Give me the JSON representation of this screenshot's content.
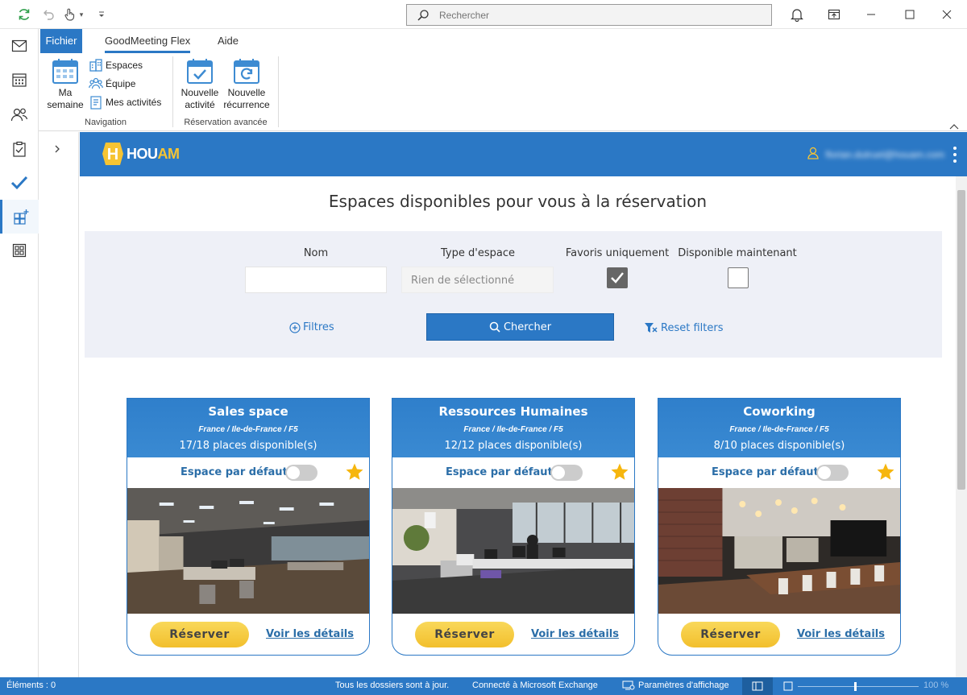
{
  "titlebar": {
    "search_placeholder": "Rechercher",
    "icons": [
      "sync-icon",
      "undo-icon",
      "touch-mode-icon",
      "customize-icon",
      "bell-icon",
      "coming-soon-icon",
      "minimize-icon",
      "maximize-icon",
      "close-icon"
    ]
  },
  "ribbon": {
    "tabs": [
      {
        "label": "Fichier"
      },
      {
        "label": "GoodMeeting Flex"
      },
      {
        "label": "Aide"
      }
    ],
    "navigation": {
      "ma_semaine": "Ma semaine",
      "ma_semaine_l1": "Ma",
      "ma_semaine_l2": "semaine",
      "espaces": "Espaces",
      "equipe": "Équipe",
      "mes_activites": "Mes activités",
      "group_label": "Navigation"
    },
    "reservation": {
      "nouvelle_activite_l1": "Nouvelle",
      "nouvelle_activite_l2": "activité",
      "nouvelle_recurrence_l1": "Nouvelle",
      "nouvelle_recurrence_l2": "récurrence",
      "group_label": "Réservation avancée"
    }
  },
  "app": {
    "logo_h": "H",
    "logo_text_a": "HOU",
    "logo_text_b": "AM",
    "user_email": "florian.dutruel@houam.com",
    "page_title": "Espaces disponibles pour vous à la réservation",
    "filters": {
      "nom_label": "Nom",
      "nom_value": "",
      "type_label": "Type d'espace",
      "type_value": "Rien de sélectionné",
      "favoris_label": "Favoris uniquement",
      "favoris_checked": true,
      "dispo_label": "Disponible maintenant",
      "dispo_checked": false,
      "filtres_link": "Filtres",
      "search_button": "Chercher",
      "reset_link": "Reset filters"
    },
    "cards": [
      {
        "title": "Sales space",
        "location": "France / Ile-de-France / F5",
        "places": "17/18 places disponible(s)",
        "default_label": "Espace par défaut",
        "default_on": false,
        "favorite": true,
        "reserve_label": "Réserver",
        "details_label": "Voir les détails"
      },
      {
        "title": "Ressources Humaines",
        "location": "France / Ile-de-France / F5",
        "places": "12/12 places disponible(s)",
        "default_label": "Espace par défaut",
        "default_on": false,
        "favorite": true,
        "reserve_label": "Réserver",
        "details_label": "Voir les détails"
      },
      {
        "title": "Coworking",
        "location": "France / Ile-de-France / F5",
        "places": "8/10 places disponible(s)",
        "default_label": "Espace par défaut",
        "default_on": false,
        "favorite": true,
        "reserve_label": "Réserver",
        "details_label": "Voir les détails"
      }
    ]
  },
  "statusbar": {
    "items": "Éléments : 0",
    "sync": "Tous les dossiers sont à jour.",
    "connection": "Connecté à Microsoft Exchange",
    "display_settings": "Paramètres d'affichage",
    "zoom": "100 %"
  },
  "colors": {
    "accent": "#2b78c5",
    "brand_yellow": "#f6c433",
    "filter_bg": "#eef0f7"
  }
}
